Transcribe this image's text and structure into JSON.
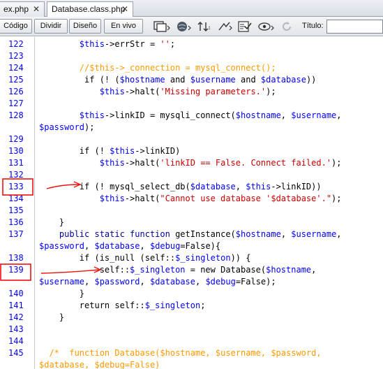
{
  "tabs": [
    {
      "label": "ex.php",
      "close": "✕"
    },
    {
      "label": "Database.class.php",
      "close": "✕"
    }
  ],
  "toolbar": {
    "view_buttons": [
      "Código",
      "Dividir",
      "Diseño",
      "En vivo"
    ],
    "tools": [
      "file-management-icon",
      "preview-browser-icon",
      "refresh-icon",
      "visual-aids-icon",
      "check-page-icon",
      "validate-icon",
      "reload-icon"
    ],
    "title_label": "Título:",
    "title_value": ""
  },
  "editor": {
    "lines": [
      {
        "n": "122",
        "segs": [
          [
            "p",
            "        "
          ],
          [
            "v",
            "$this"
          ],
          [
            "p",
            "->errStr = "
          ],
          [
            "s",
            "''"
          ],
          [
            "p",
            ";"
          ]
        ]
      },
      {
        "n": "123",
        "segs": []
      },
      {
        "n": "124",
        "segs": [
          [
            "p",
            "        "
          ],
          [
            "c",
            "//$this->_connection = mysql_connect();"
          ]
        ]
      },
      {
        "n": "125",
        "segs": [
          [
            "p",
            "         if (! ("
          ],
          [
            "v",
            "$hostname"
          ],
          [
            "p",
            " and "
          ],
          [
            "v",
            "$username"
          ],
          [
            "p",
            " and "
          ],
          [
            "v",
            "$database"
          ],
          [
            "p",
            "))"
          ]
        ]
      },
      {
        "n": "126",
        "segs": [
          [
            "p",
            "            "
          ],
          [
            "v",
            "$this"
          ],
          [
            "p",
            "->halt("
          ],
          [
            "s",
            "'Missing parameters.'"
          ],
          [
            "p",
            ");"
          ]
        ]
      },
      {
        "n": "127",
        "segs": []
      },
      {
        "n": "128",
        "segs": [
          [
            "p",
            "        "
          ],
          [
            "v",
            "$this"
          ],
          [
            "p",
            "->linkID = mysqli_connect("
          ],
          [
            "v",
            "$hostname"
          ],
          [
            "p",
            ", "
          ],
          [
            "v",
            "$username"
          ],
          [
            "p",
            ","
          ]
        ]
      },
      {
        "n": "",
        "segs": [
          [
            "v",
            "$password"
          ],
          [
            "p",
            ");"
          ]
        ]
      },
      {
        "n": "129",
        "segs": []
      },
      {
        "n": "130",
        "segs": [
          [
            "p",
            "        if (! "
          ],
          [
            "v",
            "$this"
          ],
          [
            "p",
            "->linkID)"
          ]
        ]
      },
      {
        "n": "131",
        "segs": [
          [
            "p",
            "            "
          ],
          [
            "v",
            "$this"
          ],
          [
            "p",
            "->halt("
          ],
          [
            "s",
            "'linkID == False. Connect failed.'"
          ],
          [
            "p",
            ");"
          ]
        ]
      },
      {
        "n": "132",
        "segs": []
      },
      {
        "n": "133",
        "segs": [
          [
            "p",
            "        if (! mysql_select_db("
          ],
          [
            "v",
            "$database"
          ],
          [
            "p",
            ", "
          ],
          [
            "v",
            "$this"
          ],
          [
            "p",
            "->linkID))"
          ]
        ]
      },
      {
        "n": "134",
        "segs": [
          [
            "p",
            "            "
          ],
          [
            "v",
            "$this"
          ],
          [
            "p",
            "->halt("
          ],
          [
            "s",
            "\"Cannot use database '$database'.\""
          ],
          [
            "p",
            ");"
          ]
        ]
      },
      {
        "n": "135",
        "segs": []
      },
      {
        "n": "136",
        "segs": [
          [
            "p",
            "    }"
          ]
        ]
      },
      {
        "n": "137",
        "segs": [
          [
            "p",
            "    "
          ],
          [
            "k",
            "public static function"
          ],
          [
            "p",
            " getInstance("
          ],
          [
            "v",
            "$hostname"
          ],
          [
            "p",
            ", "
          ],
          [
            "v",
            "$username"
          ],
          [
            "p",
            ","
          ]
        ]
      },
      {
        "n": "",
        "segs": [
          [
            "v",
            "$password"
          ],
          [
            "p",
            ", "
          ],
          [
            "v",
            "$database"
          ],
          [
            "p",
            ", "
          ],
          [
            "v",
            "$debug"
          ],
          [
            "p",
            "=False){"
          ]
        ]
      },
      {
        "n": "138",
        "segs": [
          [
            "p",
            "        if (is_null (self::"
          ],
          [
            "v",
            "$_singleton"
          ],
          [
            "p",
            ")) {"
          ]
        ]
      },
      {
        "n": "139",
        "segs": [
          [
            "p",
            "            self::"
          ],
          [
            "v",
            "$_singleton"
          ],
          [
            "p",
            " = new Database("
          ],
          [
            "v",
            "$hostname"
          ],
          [
            "p",
            ","
          ]
        ]
      },
      {
        "n": "",
        "segs": [
          [
            "v",
            "$username"
          ],
          [
            "p",
            ", "
          ],
          [
            "v",
            "$password"
          ],
          [
            "p",
            ", "
          ],
          [
            "v",
            "$database"
          ],
          [
            "p",
            ", "
          ],
          [
            "v",
            "$debug"
          ],
          [
            "p",
            "=False);"
          ]
        ]
      },
      {
        "n": "140",
        "segs": [
          [
            "p",
            "        }"
          ]
        ]
      },
      {
        "n": "141",
        "segs": [
          [
            "p",
            "        return self::"
          ],
          [
            "v",
            "$_singleton"
          ],
          [
            "p",
            ";"
          ]
        ]
      },
      {
        "n": "142",
        "segs": [
          [
            "p",
            "    }"
          ]
        ]
      },
      {
        "n": "143",
        "segs": []
      },
      {
        "n": "144",
        "segs": []
      },
      {
        "n": "145",
        "segs": [
          [
            "p",
            "  "
          ],
          [
            "c",
            "/*  function Database($hostname, $username, $password,"
          ]
        ]
      },
      {
        "n": "",
        "segs": [
          [
            "c",
            "$database, $debug=False)"
          ]
        ]
      }
    ]
  },
  "colors": {
    "variable": "#0000ff",
    "string": "#cc0000",
    "comment": "#ff9900",
    "keyword": "#000099",
    "line_number": "#0000ff",
    "annotation": "#ee1111"
  },
  "annotations": {
    "highlighted_lines": [
      "133",
      "139"
    ]
  }
}
